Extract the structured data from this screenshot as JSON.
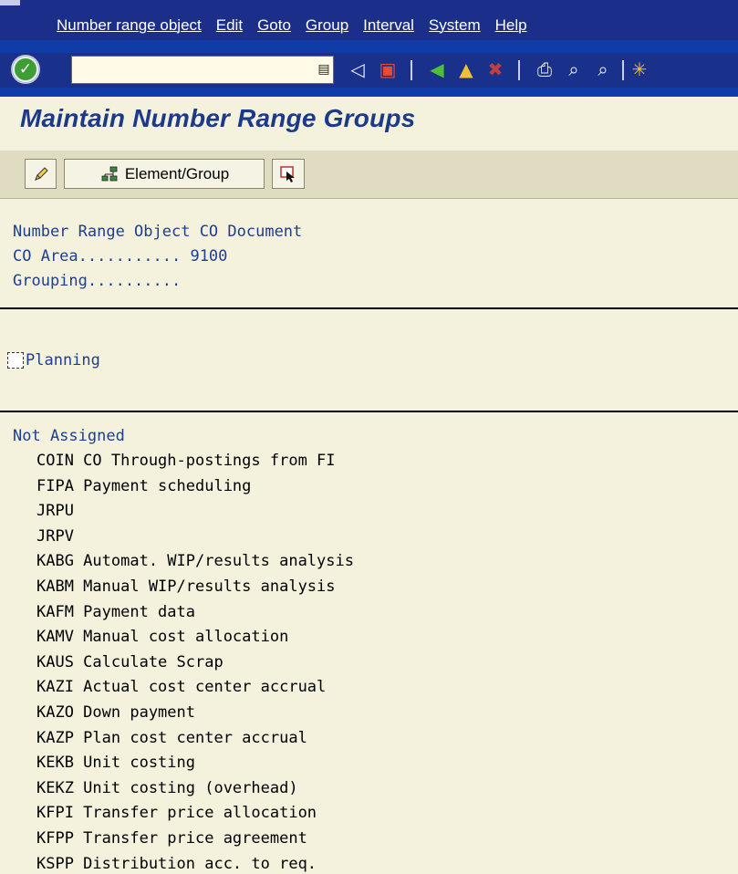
{
  "menu": {
    "items": [
      "Number range object",
      "Edit",
      "Goto",
      "Group",
      "Interval",
      "System",
      "Help"
    ]
  },
  "toolbar": {
    "command_value": "",
    "icons": [
      "enter-check-icon",
      "command-field",
      "save-icon",
      "back-icon",
      "exit-icon",
      "cancel-icon",
      "print-icon",
      "find-icon",
      "find-next-icon"
    ]
  },
  "title": "Maintain Number Range Groups",
  "app_toolbar": {
    "element_group_label": "Element/Group"
  },
  "header": {
    "object_line": "Number Range Object CO Document",
    "co_area_line": "CO Area........... 9100",
    "grouping_line": "Grouping.........."
  },
  "group": {
    "label": "Planning"
  },
  "not_assigned": {
    "title": "Not Assigned",
    "items": [
      "COIN CO Through-postings from FI",
      "FIPA Payment scheduling",
      "JRPU",
      "JRPV",
      "KABG Automat. WIP/results analysis",
      "KABM Manual WIP/results analysis",
      "KAFM Payment data",
      "KAMV Manual cost allocation",
      "KAUS Calculate Scrap",
      "KAZI Actual cost center accrual",
      "KAZO Down payment",
      "KAZP Plan cost center accrual",
      "KEKB Unit costing",
      "KEKZ Unit costing (overhead)",
      "KFPI Transfer price allocation",
      "KFPP Transfer price agreement",
      "KSPP Distribution acc. to req."
    ]
  }
}
